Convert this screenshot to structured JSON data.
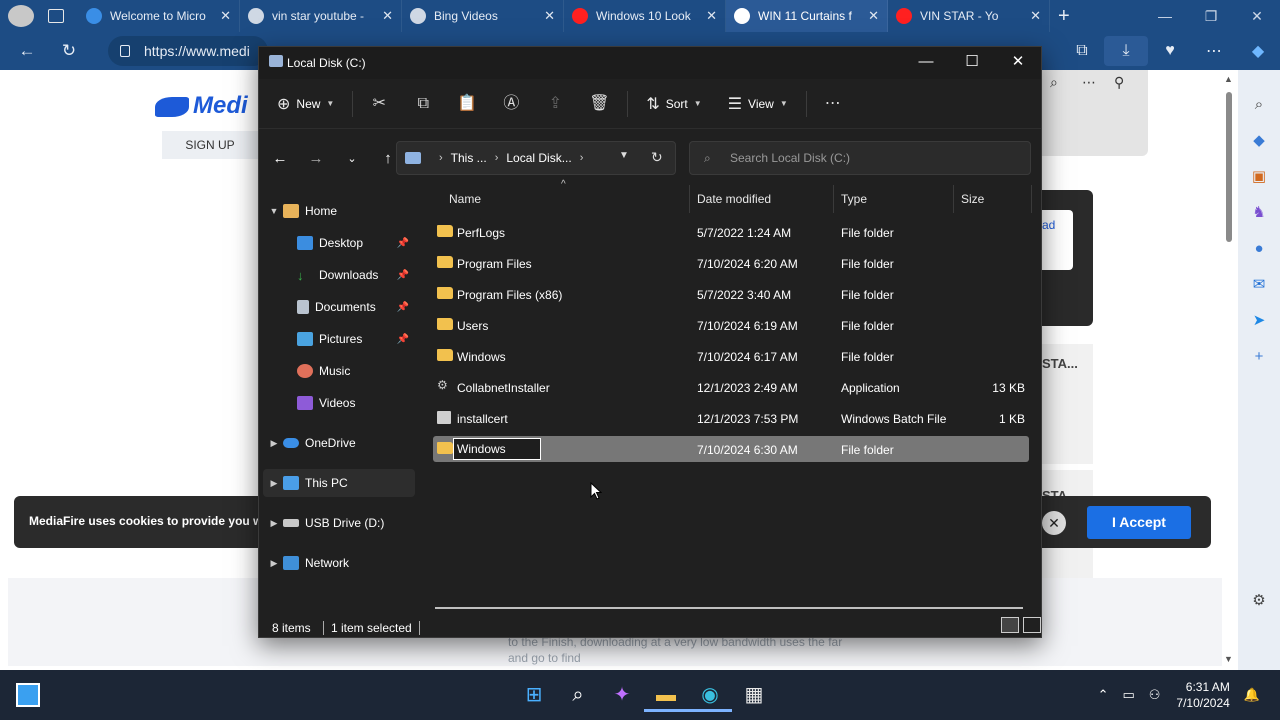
{
  "browser": {
    "tabs": [
      {
        "label": "Welcome to Micro",
        "icon": "edge-icon",
        "color": "#3a8ee6",
        "active": false
      },
      {
        "label": "vin star youtube -",
        "icon": "search-icon",
        "color": "#cfd8e4",
        "active": false
      },
      {
        "label": "Bing Videos",
        "icon": "search-icon",
        "color": "#cfd8e4",
        "active": false
      },
      {
        "label": "Windows 10 Look",
        "icon": "youtube-icon",
        "color": "#ff2020",
        "active": false
      },
      {
        "label": "WIN 11 Curtains f",
        "icon": "mediafire-icon",
        "color": "#ffffff",
        "active": true
      },
      {
        "label": "VIN STAR - Yo",
        "icon": "youtube-icon",
        "color": "#ff2020",
        "active": false
      }
    ],
    "url": "https://www.medi"
  },
  "page": {
    "logo": "Medi",
    "signup": "SIGN UP",
    "side_text_1": "ad",
    "side_text_2": "STA...",
    "side_text_3": "STA...",
    "cookie_text": "MediaFire uses cookies to provide you w",
    "accept_label": "I Accept",
    "bottom_text": "to the Finish, downloading at a very low bandwidth uses the far and go to find"
  },
  "explorer": {
    "title": "Local Disk (C:)",
    "toolbar": {
      "new_label": "New",
      "sort_label": "Sort",
      "view_label": "View"
    },
    "breadcrumb": [
      "This ...",
      "Local Disk..."
    ],
    "search_placeholder": "Search Local Disk (C:)",
    "nav": {
      "home": "Home",
      "desktop": "Desktop",
      "downloads": "Downloads",
      "documents": "Documents",
      "pictures": "Pictures",
      "music": "Music",
      "videos": "Videos",
      "onedrive": "OneDrive",
      "thispc": "This PC",
      "usb": "USB Drive (D:)",
      "network": "Network"
    },
    "columns": {
      "name": "Name",
      "date": "Date modified",
      "type": "Type",
      "size": "Size"
    },
    "files": [
      {
        "name": "PerfLogs",
        "date": "5/7/2022 1:24 AM",
        "type": "File folder",
        "size": "",
        "kind": "folder"
      },
      {
        "name": "Program Files",
        "date": "7/10/2024 6:20 AM",
        "type": "File folder",
        "size": "",
        "kind": "folder"
      },
      {
        "name": "Program Files (x86)",
        "date": "5/7/2022 3:40 AM",
        "type": "File folder",
        "size": "",
        "kind": "folder"
      },
      {
        "name": "Users",
        "date": "7/10/2024 6:19 AM",
        "type": "File folder",
        "size": "",
        "kind": "folder"
      },
      {
        "name": "Windows",
        "date": "7/10/2024 6:17 AM",
        "type": "File folder",
        "size": "",
        "kind": "folder"
      },
      {
        "name": "CollabnetInstaller",
        "date": "12/1/2023 2:49 AM",
        "type": "Application",
        "size": "13 KB",
        "kind": "app"
      },
      {
        "name": "installcert",
        "date": "12/1/2023 7:53 PM",
        "type": "Windows Batch File",
        "size": "1 KB",
        "kind": "bat"
      },
      {
        "name": "",
        "date": "7/10/2024 6:30 AM",
        "type": "File folder",
        "size": "",
        "kind": "folder",
        "renaming": true
      }
    ],
    "rename_value": "Windows",
    "status": {
      "items": "8 items",
      "selected": "1 item selected"
    }
  },
  "taskbar": {
    "time": "6:31 AM",
    "date": "7/10/2024"
  }
}
